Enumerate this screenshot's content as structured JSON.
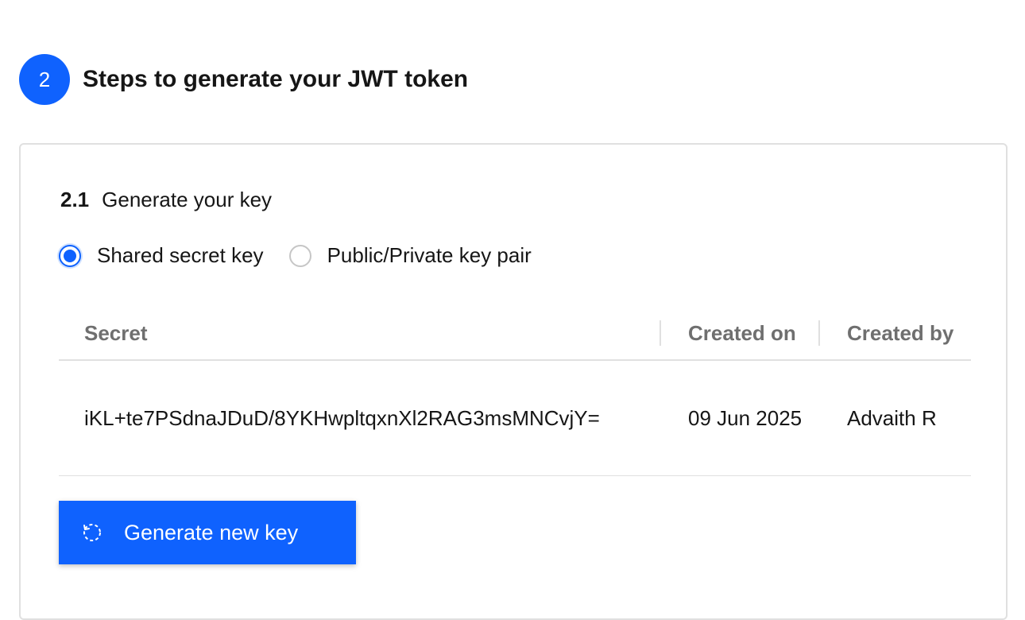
{
  "step": {
    "number": "2",
    "title": "Steps to generate your JWT token"
  },
  "section": {
    "number": "2.1",
    "title": "Generate your key"
  },
  "key_type": {
    "options": [
      {
        "label": "Shared secret key",
        "selected": true
      },
      {
        "label": "Public/Private key pair",
        "selected": false
      }
    ]
  },
  "table": {
    "headers": {
      "secret": "Secret",
      "created_on": "Created on",
      "created_by": "Created by"
    },
    "rows": [
      {
        "secret": "iKL+te7PSdnaJDuD/8YKHwpltqxnXl2RAG3msMNCvjY=",
        "created_on": "09 Jun 2025",
        "created_by": "Advaith R"
      }
    ]
  },
  "actions": {
    "generate_label": "Generate new key",
    "generate_icon": "renew-icon"
  },
  "colors": {
    "accent": "#0f62fe",
    "border": "#e0e0e0",
    "header_text": "#6f6f6f",
    "text": "#161616"
  }
}
